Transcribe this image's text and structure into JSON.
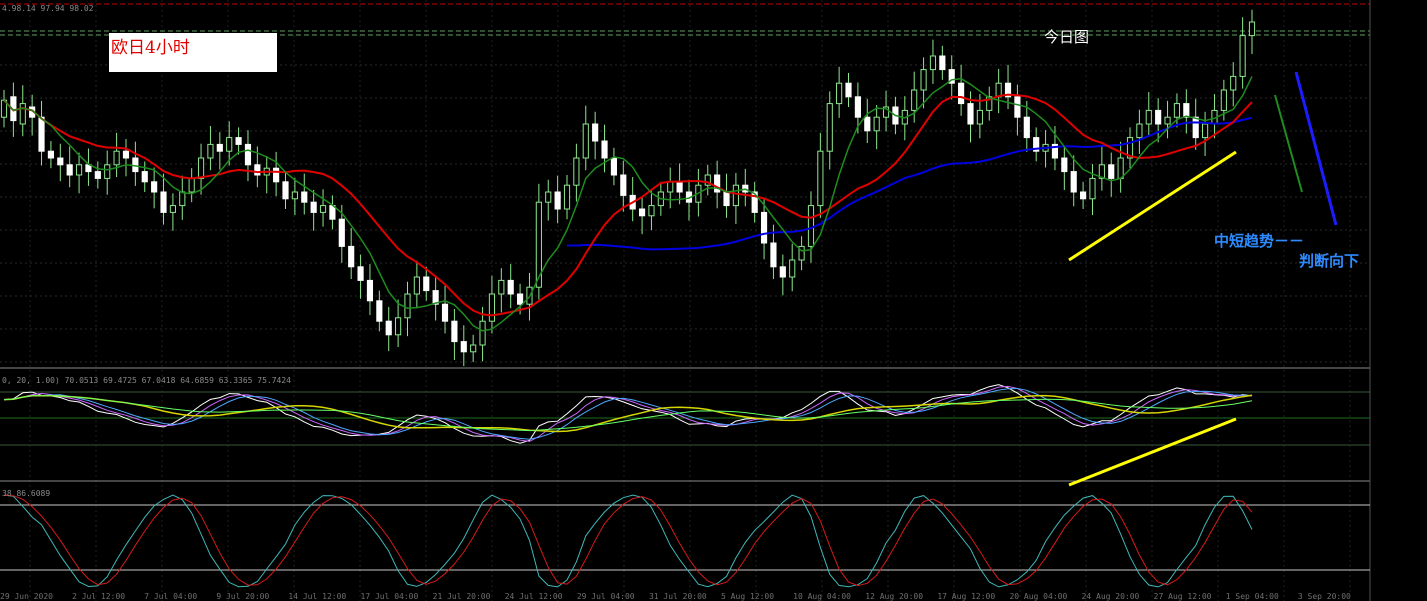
{
  "chart_data": [
    {
      "type": "candlestick",
      "title": "欧日4小时",
      "annotations": [
        "今日图",
        "中短趋势－－",
        "判断向下"
      ],
      "ohlc_readout": "4.98.14 97.94 98.02",
      "x_tick_labels": [
        "29 Jun 2020",
        "2 Jul 12:00",
        "7 Jul 04:00",
        "9 Jul 20:00",
        "14 Jul 12:00",
        "17 Jul 04:00",
        "21 Jul 20:00",
        "24 Jul 12:00",
        "29 Jul 04:00",
        "31 Jul 20:00",
        "5 Aug 12:00",
        "10 Aug 04:00",
        "12 Aug 20:00",
        "17 Aug 12:00",
        "20 Aug 04:00",
        "24 Aug 20:00",
        "27 Aug 12:00",
        "1 Sep 04:00",
        "3 Sep 20:00"
      ],
      "candles": [
        {
          "o": 0.72,
          "c": 0.77
        },
        {
          "o": 0.78,
          "c": 0.71
        },
        {
          "o": 0.7,
          "c": 0.76
        },
        {
          "o": 0.75,
          "c": 0.72
        },
        {
          "o": 0.72,
          "c": 0.62
        },
        {
          "o": 0.62,
          "c": 0.6
        },
        {
          "o": 0.6,
          "c": 0.58
        },
        {
          "o": 0.58,
          "c": 0.55
        },
        {
          "o": 0.55,
          "c": 0.58
        },
        {
          "o": 0.58,
          "c": 0.56
        },
        {
          "o": 0.56,
          "c": 0.54
        },
        {
          "o": 0.54,
          "c": 0.58
        },
        {
          "o": 0.58,
          "c": 0.62
        },
        {
          "o": 0.62,
          "c": 0.6
        },
        {
          "o": 0.6,
          "c": 0.56
        },
        {
          "o": 0.56,
          "c": 0.53
        },
        {
          "o": 0.53,
          "c": 0.5
        },
        {
          "o": 0.5,
          "c": 0.44
        },
        {
          "o": 0.44,
          "c": 0.46
        },
        {
          "o": 0.46,
          "c": 0.5
        },
        {
          "o": 0.5,
          "c": 0.54
        },
        {
          "o": 0.54,
          "c": 0.6
        },
        {
          "o": 0.6,
          "c": 0.64
        },
        {
          "o": 0.64,
          "c": 0.62
        },
        {
          "o": 0.62,
          "c": 0.66
        },
        {
          "o": 0.66,
          "c": 0.64
        },
        {
          "o": 0.64,
          "c": 0.58
        },
        {
          "o": 0.58,
          "c": 0.55
        },
        {
          "o": 0.55,
          "c": 0.57
        },
        {
          "o": 0.57,
          "c": 0.53
        },
        {
          "o": 0.53,
          "c": 0.48
        },
        {
          "o": 0.48,
          "c": 0.5
        },
        {
          "o": 0.5,
          "c": 0.47
        },
        {
          "o": 0.47,
          "c": 0.44
        },
        {
          "o": 0.44,
          "c": 0.46
        },
        {
          "o": 0.46,
          "c": 0.42
        },
        {
          "o": 0.42,
          "c": 0.34
        },
        {
          "o": 0.34,
          "c": 0.28
        },
        {
          "o": 0.28,
          "c": 0.24
        },
        {
          "o": 0.24,
          "c": 0.18
        },
        {
          "o": 0.18,
          "c": 0.12
        },
        {
          "o": 0.12,
          "c": 0.08
        },
        {
          "o": 0.08,
          "c": 0.13
        },
        {
          "o": 0.13,
          "c": 0.2
        },
        {
          "o": 0.2,
          "c": 0.25
        },
        {
          "o": 0.25,
          "c": 0.21
        },
        {
          "o": 0.21,
          "c": 0.17
        },
        {
          "o": 0.17,
          "c": 0.12
        },
        {
          "o": 0.12,
          "c": 0.06
        },
        {
          "o": 0.06,
          "c": 0.03
        },
        {
          "o": 0.03,
          "c": 0.05
        },
        {
          "o": 0.05,
          "c": 0.12
        },
        {
          "o": 0.12,
          "c": 0.2
        },
        {
          "o": 0.2,
          "c": 0.24
        },
        {
          "o": 0.24,
          "c": 0.2
        },
        {
          "o": 0.2,
          "c": 0.17
        },
        {
          "o": 0.17,
          "c": 0.22
        },
        {
          "o": 0.22,
          "c": 0.47
        },
        {
          "o": 0.47,
          "c": 0.5
        },
        {
          "o": 0.5,
          "c": 0.45
        },
        {
          "o": 0.45,
          "c": 0.52
        },
        {
          "o": 0.52,
          "c": 0.6
        },
        {
          "o": 0.6,
          "c": 0.7
        },
        {
          "o": 0.7,
          "c": 0.65
        },
        {
          "o": 0.65,
          "c": 0.6
        },
        {
          "o": 0.6,
          "c": 0.55
        },
        {
          "o": 0.55,
          "c": 0.49
        },
        {
          "o": 0.49,
          "c": 0.45
        },
        {
          "o": 0.45,
          "c": 0.43
        },
        {
          "o": 0.43,
          "c": 0.46
        },
        {
          "o": 0.46,
          "c": 0.5
        },
        {
          "o": 0.5,
          "c": 0.53
        },
        {
          "o": 0.53,
          "c": 0.5
        },
        {
          "o": 0.5,
          "c": 0.47
        },
        {
          "o": 0.47,
          "c": 0.52
        },
        {
          "o": 0.52,
          "c": 0.55
        },
        {
          "o": 0.55,
          "c": 0.5
        },
        {
          "o": 0.5,
          "c": 0.46
        },
        {
          "o": 0.46,
          "c": 0.52
        },
        {
          "o": 0.52,
          "c": 0.5
        },
        {
          "o": 0.5,
          "c": 0.44
        },
        {
          "o": 0.44,
          "c": 0.35
        },
        {
          "o": 0.35,
          "c": 0.28
        },
        {
          "o": 0.28,
          "c": 0.25
        },
        {
          "o": 0.25,
          "c": 0.3
        },
        {
          "o": 0.3,
          "c": 0.34
        },
        {
          "o": 0.34,
          "c": 0.46
        },
        {
          "o": 0.46,
          "c": 0.62
        },
        {
          "o": 0.62,
          "c": 0.76
        },
        {
          "o": 0.76,
          "c": 0.82
        },
        {
          "o": 0.82,
          "c": 0.78
        },
        {
          "o": 0.78,
          "c": 0.72
        },
        {
          "o": 0.72,
          "c": 0.68
        },
        {
          "o": 0.68,
          "c": 0.72
        },
        {
          "o": 0.72,
          "c": 0.75
        },
        {
          "o": 0.75,
          "c": 0.7
        },
        {
          "o": 0.7,
          "c": 0.74
        },
        {
          "o": 0.74,
          "c": 0.8
        },
        {
          "o": 0.8,
          "c": 0.86
        },
        {
          "o": 0.86,
          "c": 0.9
        },
        {
          "o": 0.9,
          "c": 0.86
        },
        {
          "o": 0.86,
          "c": 0.82
        },
        {
          "o": 0.82,
          "c": 0.76
        },
        {
          "o": 0.76,
          "c": 0.7
        },
        {
          "o": 0.7,
          "c": 0.74
        },
        {
          "o": 0.74,
          "c": 0.78
        },
        {
          "o": 0.78,
          "c": 0.82
        },
        {
          "o": 0.82,
          "c": 0.78
        },
        {
          "o": 0.78,
          "c": 0.72
        },
        {
          "o": 0.72,
          "c": 0.66
        },
        {
          "o": 0.66,
          "c": 0.62
        },
        {
          "o": 0.62,
          "c": 0.64
        },
        {
          "o": 0.64,
          "c": 0.6
        },
        {
          "o": 0.6,
          "c": 0.56
        },
        {
          "o": 0.56,
          "c": 0.5
        },
        {
          "o": 0.5,
          "c": 0.48
        },
        {
          "o": 0.48,
          "c": 0.54
        },
        {
          "o": 0.54,
          "c": 0.58
        },
        {
          "o": 0.58,
          "c": 0.54
        },
        {
          "o": 0.54,
          "c": 0.6
        },
        {
          "o": 0.6,
          "c": 0.66
        },
        {
          "o": 0.66,
          "c": 0.7
        },
        {
          "o": 0.7,
          "c": 0.74
        },
        {
          "o": 0.74,
          "c": 0.7
        },
        {
          "o": 0.7,
          "c": 0.72
        },
        {
          "o": 0.72,
          "c": 0.76
        },
        {
          "o": 0.76,
          "c": 0.72
        },
        {
          "o": 0.72,
          "c": 0.66
        },
        {
          "o": 0.66,
          "c": 0.7
        },
        {
          "o": 0.7,
          "c": 0.74
        },
        {
          "o": 0.74,
          "c": 0.8
        },
        {
          "o": 0.8,
          "c": 0.84
        },
        {
          "o": 0.84,
          "c": 0.96
        },
        {
          "o": 0.96,
          "c": 1.0
        }
      ],
      "series": [
        {
          "name": "",
          "color": "#e00000",
          "values": []
        },
        {
          "name": "",
          "color": "#0000e0",
          "values": []
        },
        {
          "name": "",
          "color": "#1e8c1e",
          "values": []
        }
      ]
    },
    {
      "type": "line",
      "readout": "0, 20, 1.00) 70.0513 69.4725 67.0418 64.6859 63.3365 75.7424",
      "series": [
        {
          "name": "",
          "color": "#ffffff",
          "values": []
        },
        {
          "name": "",
          "color": "#4da6ff",
          "values": []
        },
        {
          "name": "",
          "color": "#cc66ff",
          "values": []
        },
        {
          "name": "",
          "color": "#d6d600",
          "values": []
        },
        {
          "name": "",
          "color": "#66ff66",
          "values": []
        }
      ]
    },
    {
      "type": "line",
      "readout": "38 86.6089",
      "series": [
        {
          "name": "",
          "color": "#d61a1a",
          "values": []
        },
        {
          "name": "",
          "color": "#3fb8b8",
          "values": []
        }
      ]
    }
  ]
}
